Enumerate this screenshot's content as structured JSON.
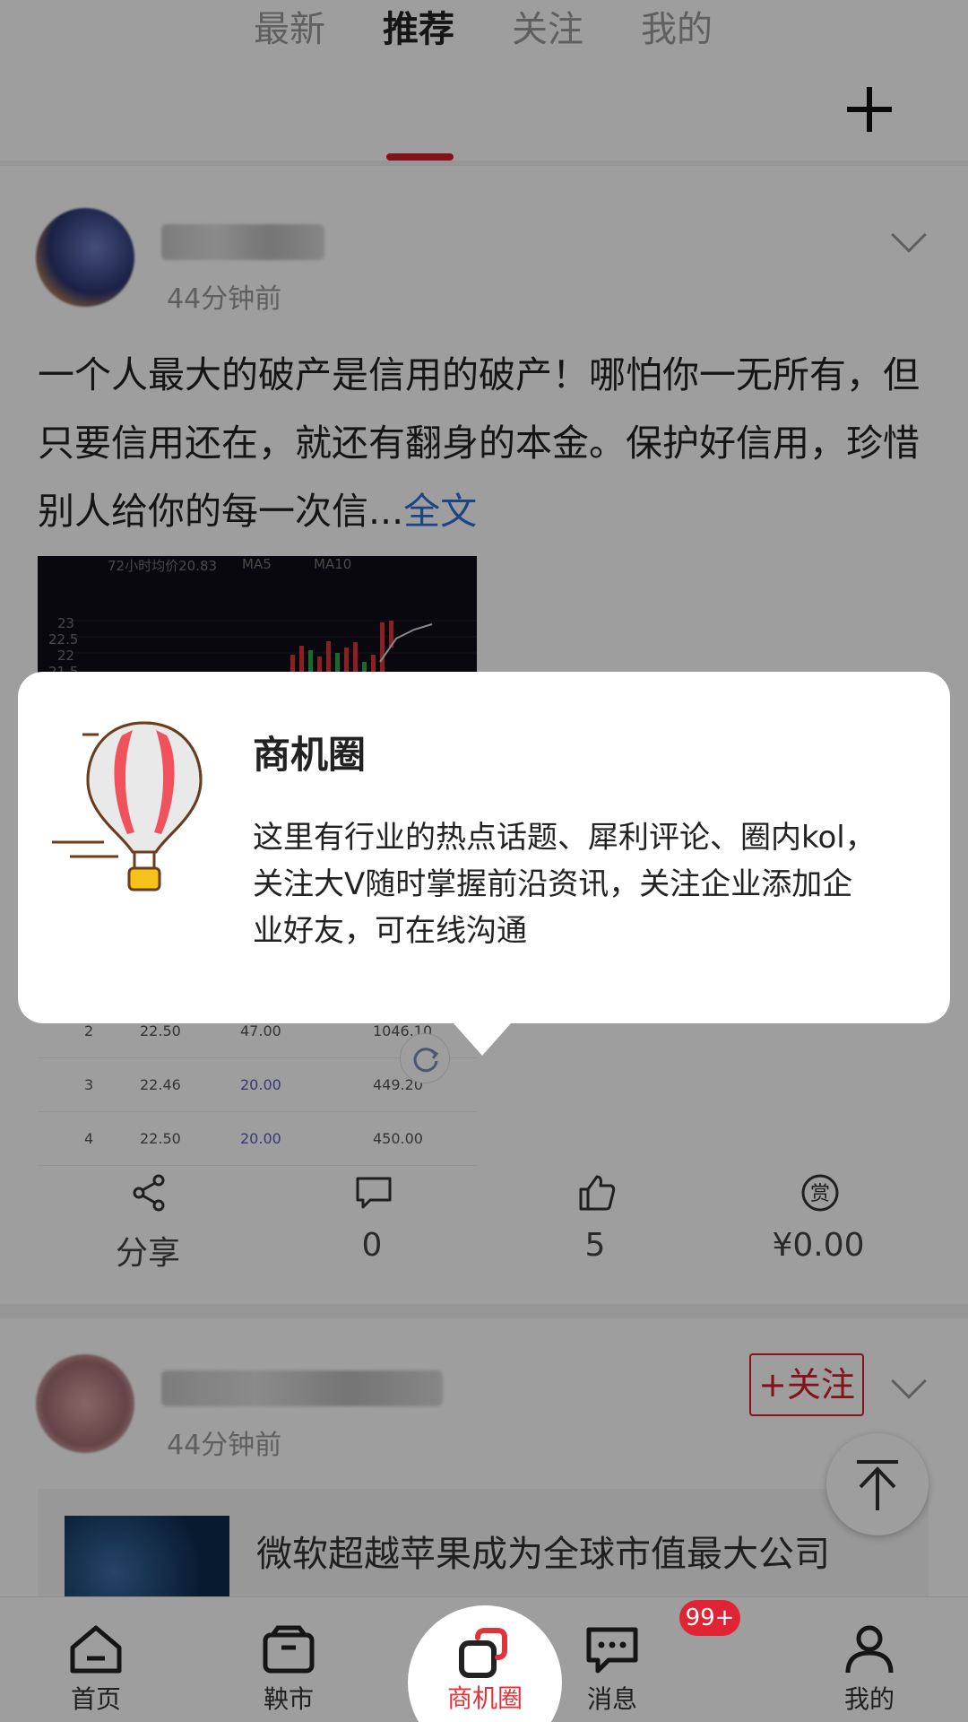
{
  "top_tabs": {
    "items": [
      {
        "label": "最新"
      },
      {
        "label": "推荐"
      },
      {
        "label": "关注"
      },
      {
        "label": "我的"
      }
    ],
    "active_index": 1
  },
  "post1": {
    "time": "44分钟前",
    "text": "一个人最大的破产是信用的破产！哪怕你一无所有，但只要信用还在，就还有翻身的本金。保护好信用，珍惜别人给你的每一次信...",
    "more_link": "全文",
    "chart_legend": [
      "72小时均价20.83",
      "MA5",
      "MA10"
    ],
    "chart_ticks": [
      "23",
      "22.5",
      "22",
      "21.5"
    ],
    "table_rows": [
      {
        "rank": "2",
        "price": "22.50",
        "qty": "47.00",
        "total": "1046.10"
      },
      {
        "rank": "3",
        "price": "22.46",
        "qty": "20.00",
        "total": "449.20"
      },
      {
        "rank": "4",
        "price": "22.50",
        "qty": "20.00",
        "total": "450.00"
      }
    ],
    "actions": {
      "share": "分享",
      "comment": "0",
      "like": "5",
      "reward": "¥0.00"
    }
  },
  "post2": {
    "time": "44分钟前",
    "follow_label": "+关注",
    "article_title": "微软超越苹果成为全球市值最大公司"
  },
  "tooltip": {
    "title": "商机圈",
    "body": "这里有行业的热点话题、犀利评论、圈内kol，关注大V随时掌握前沿资讯，关注企业添加企业好友，可在线沟通"
  },
  "bottom_nav": {
    "items": [
      {
        "label": "首页",
        "icon": "home-icon"
      },
      {
        "label": "鞅市",
        "icon": "box-icon"
      },
      {
        "label": "商机圈",
        "icon": "circle-icon"
      },
      {
        "label": "消息",
        "icon": "chat-icon"
      },
      {
        "label": "我的",
        "icon": "user-icon"
      }
    ],
    "active_index": 2,
    "message_badge": "99+"
  },
  "colors": {
    "accent_red": "#d61d2b",
    "link_blue": "#2f6fd6"
  }
}
